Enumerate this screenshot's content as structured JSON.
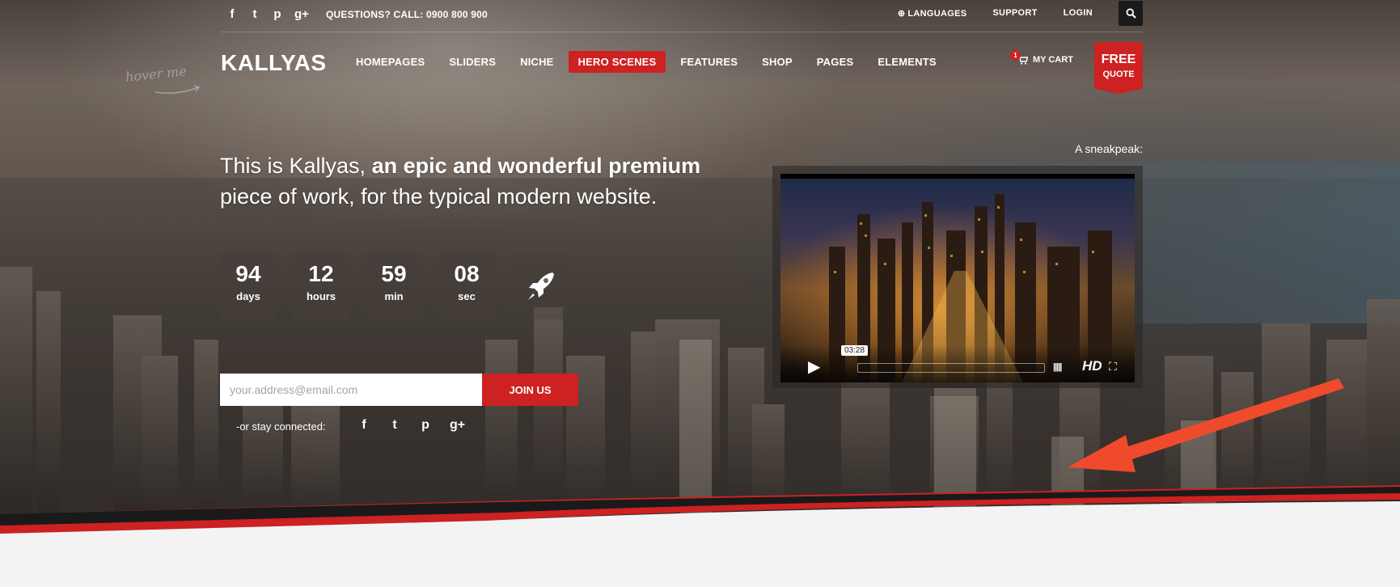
{
  "topbar": {
    "social": [
      "f",
      "t",
      "p",
      "g+"
    ],
    "questions": "QUESTIONS? CALL: 0900 800 900",
    "languages": "LANGUAGES",
    "support": "SUPPORT",
    "login": "LOGIN",
    "search_icon": "search-icon"
  },
  "header": {
    "logo": "KALLYAS",
    "hover_me": "hover me",
    "nav": [
      "HOMEPAGES",
      "SLIDERS",
      "NICHE",
      "HERO SCENES",
      "FEATURES",
      "SHOP",
      "PAGES",
      "ELEMENTS"
    ],
    "active_nav": "HERO SCENES",
    "cart_count": "1",
    "cart_label": "MY CART",
    "free_quote_top": "FREE",
    "free_quote_bottom": "QUOTE"
  },
  "hero": {
    "headline_normal": "This is Kallyas, ",
    "headline_bold": "an epic and wonderful premium",
    "headline_line2": "piece of work, for the typical modern website.",
    "countdown": [
      {
        "value": "94",
        "label": "days"
      },
      {
        "value": "12",
        "label": "hours"
      },
      {
        "value": "59",
        "label": "min"
      },
      {
        "value": "08",
        "label": "sec"
      }
    ],
    "email_placeholder": "your.address@email.com",
    "join_label": "JOIN US",
    "stay_connected": "-or stay connected:",
    "social": [
      "f",
      "t",
      "p",
      "g+"
    ]
  },
  "video": {
    "sneak": "A sneakpeak:",
    "time": "03:28",
    "hd": "HD"
  },
  "colors": {
    "accent": "#cd2122",
    "bottom_bg": "#f3f3f3"
  }
}
